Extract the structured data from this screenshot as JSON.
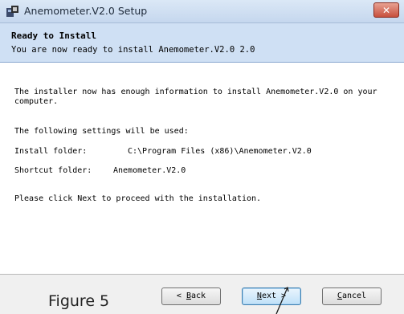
{
  "window": {
    "title": "Anemometer.V2.0 Setup",
    "close_label": "✕"
  },
  "header": {
    "title": "Ready to Install",
    "subtitle": "You are now ready to install Anemometer.V2.0 2.0"
  },
  "content": {
    "intro_line1": "The installer now has enough information to install Anemometer.V2.0 on your",
    "intro_line2": "computer.",
    "settings_heading": "The following settings will be used:",
    "install_folder_label": "Install folder:",
    "install_folder_value": "C:\\Program Files (x86)\\Anemometer.V2.0",
    "shortcut_folder_label": "Shortcut folder:",
    "shortcut_folder_value": "Anemometer.V2.0",
    "instruction": "Please click Next to proceed with the installation."
  },
  "buttons": {
    "back": {
      "prefix": "< ",
      "accel": "B",
      "rest": "ack"
    },
    "next": {
      "accel": "N",
      "rest": "ext",
      "suffix": " >"
    },
    "cancel": {
      "accel": "C",
      "rest": "ancel"
    }
  },
  "caption": "Figure 5"
}
